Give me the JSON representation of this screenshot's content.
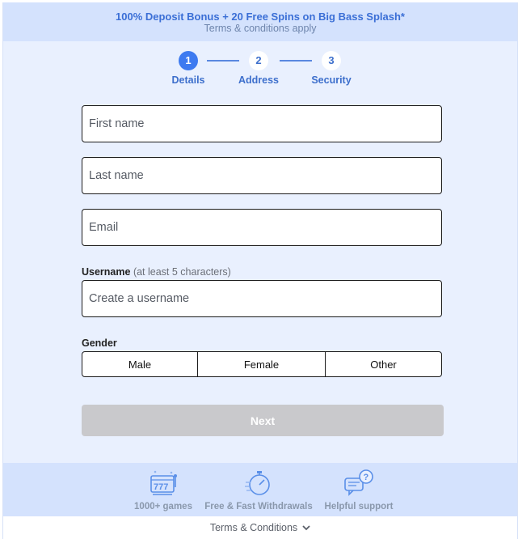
{
  "promo": {
    "title": "100% Deposit Bonus + 20 Free Spins on Big Bass Splash*",
    "subtitle": "Terms & conditions apply"
  },
  "stepper": {
    "steps": [
      {
        "number": "1",
        "label": "Details",
        "active": true
      },
      {
        "number": "2",
        "label": "Address",
        "active": false
      },
      {
        "number": "3",
        "label": "Security",
        "active": false
      }
    ]
  },
  "form": {
    "first_name": {
      "placeholder": "First name",
      "value": ""
    },
    "last_name": {
      "placeholder": "Last name",
      "value": ""
    },
    "email": {
      "placeholder": "Email",
      "value": ""
    },
    "username": {
      "label": "Username",
      "hint": "(at least 5 characters)",
      "placeholder": "Create a username",
      "value": ""
    },
    "gender": {
      "label": "Gender",
      "options": [
        "Male",
        "Female",
        "Other"
      ]
    },
    "next_label": "Next"
  },
  "features": [
    {
      "label": "1000+ games",
      "icon": "slot-machine-icon"
    },
    {
      "label": "Free & Fast Withdrawals",
      "icon": "stopwatch-icon"
    },
    {
      "label": "Helpful support",
      "icon": "chat-support-icon"
    }
  ],
  "footer": {
    "terms_label": "Terms & Conditions"
  },
  "colors": {
    "accent": "#3d7af0",
    "background": "#e9f0fe",
    "band": "#d4e2fd",
    "disabled_button": "#c9c9cc"
  }
}
